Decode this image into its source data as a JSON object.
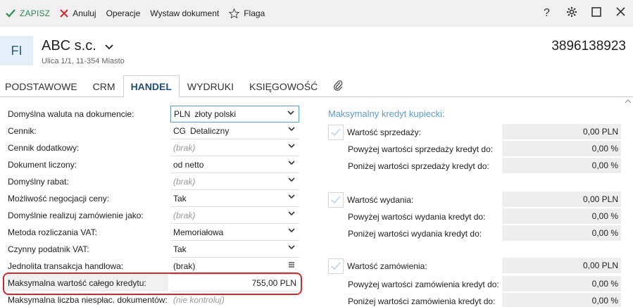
{
  "toolbar": {
    "save": "ZAPISZ",
    "cancel": "Anuluj",
    "operations": "Operacje",
    "issue_document": "Wystaw dokument",
    "flag": "Flaga",
    "help": "?",
    "colors": {
      "save": "#2e8b57",
      "cancel": "#d9262a"
    }
  },
  "header": {
    "badge": "FI",
    "company": "ABC s.c.",
    "address": "Ulica 1/1, 11-354 Miasto",
    "code": "3896138923"
  },
  "tabs": [
    "PODSTAWOWE",
    "CRM",
    "HANDEL",
    "WYDRUKI",
    "KSIĘGOWOŚĆ"
  ],
  "active_tab": "HANDEL",
  "form": [
    {
      "label": "Domyślna waluta na dokumencie:",
      "prefix": "PLN",
      "value": "złoty polski",
      "placeholder": false,
      "control": "dropdown"
    },
    {
      "label": "Cennik:",
      "prefix": "CG",
      "value": "Detaliczny",
      "placeholder": false,
      "control": "dropdown"
    },
    {
      "label": "Cennik dodatkowy:",
      "prefix": "",
      "value": "(brak)",
      "placeholder": true,
      "control": "dropdown"
    },
    {
      "label": "Dokument liczony:",
      "prefix": "",
      "value": "od netto",
      "placeholder": false,
      "control": "dropdown"
    },
    {
      "label": "Domyślny rabat:",
      "prefix": "",
      "value": "(brak)",
      "placeholder": true,
      "control": "dropdown"
    },
    {
      "label": "Możliwość negocjacji ceny:",
      "prefix": "",
      "value": "Tak",
      "placeholder": false,
      "control": "dropdown"
    },
    {
      "label": "Domyślnie realizuj zamówienie jako:",
      "prefix": "",
      "value": "(brak)",
      "placeholder": true,
      "control": "dropdown"
    },
    {
      "label": "Metoda rozliczania VAT:",
      "prefix": "",
      "value": "Memoriałowa",
      "placeholder": false,
      "control": "dropdown"
    },
    {
      "label": "Czynny podatnik VAT:",
      "prefix": "",
      "value": "Tak",
      "placeholder": false,
      "control": "dropdown"
    },
    {
      "label": "Jednolita transakcja handlowa:",
      "prefix": "",
      "value": "(brak)",
      "placeholder": false,
      "control": "list"
    },
    {
      "label": "Maksymalna wartość całego kredytu:",
      "prefix": "",
      "value": "755,00 PLN",
      "placeholder": false,
      "control": "number"
    },
    {
      "label": "Maksymalna liczba niespłac. dokumentów:",
      "prefix": "",
      "value": "(nie kontroluj)",
      "placeholder": true,
      "control": "none"
    }
  ],
  "credit": {
    "title": "Maksymalny kredyt kupiecki:",
    "rows": [
      {
        "type": "check",
        "label": "Wartość sprzedaży:",
        "value": "0,00 PLN"
      },
      {
        "type": "sub",
        "label": "Powyżej wartości sprzedaży kredyt do:",
        "value": "0,00 %"
      },
      {
        "type": "sub",
        "label": "Poniżej wartości sprzedaży kredyt do:",
        "value": "0,00 %"
      },
      {
        "type": "check",
        "label": "Wartość wydania:",
        "value": "0,00 PLN"
      },
      {
        "type": "sub",
        "label": "Powyżej wartości wydania kredyt do:",
        "value": "0,00 %"
      },
      {
        "type": "sub",
        "label": "Poniżej wartości wydania kredyt do:",
        "value": "0,00 %"
      },
      {
        "type": "check",
        "label": "Wartość zamówienia:",
        "value": "0,00 PLN"
      },
      {
        "type": "sub",
        "label": "Powyżej wartości zamówienia kredyt do:",
        "value": "0,00 %"
      },
      {
        "type": "sub",
        "label": "Poniżej wartości zamówienia kredyt do:",
        "value": "0,00 %"
      }
    ]
  }
}
